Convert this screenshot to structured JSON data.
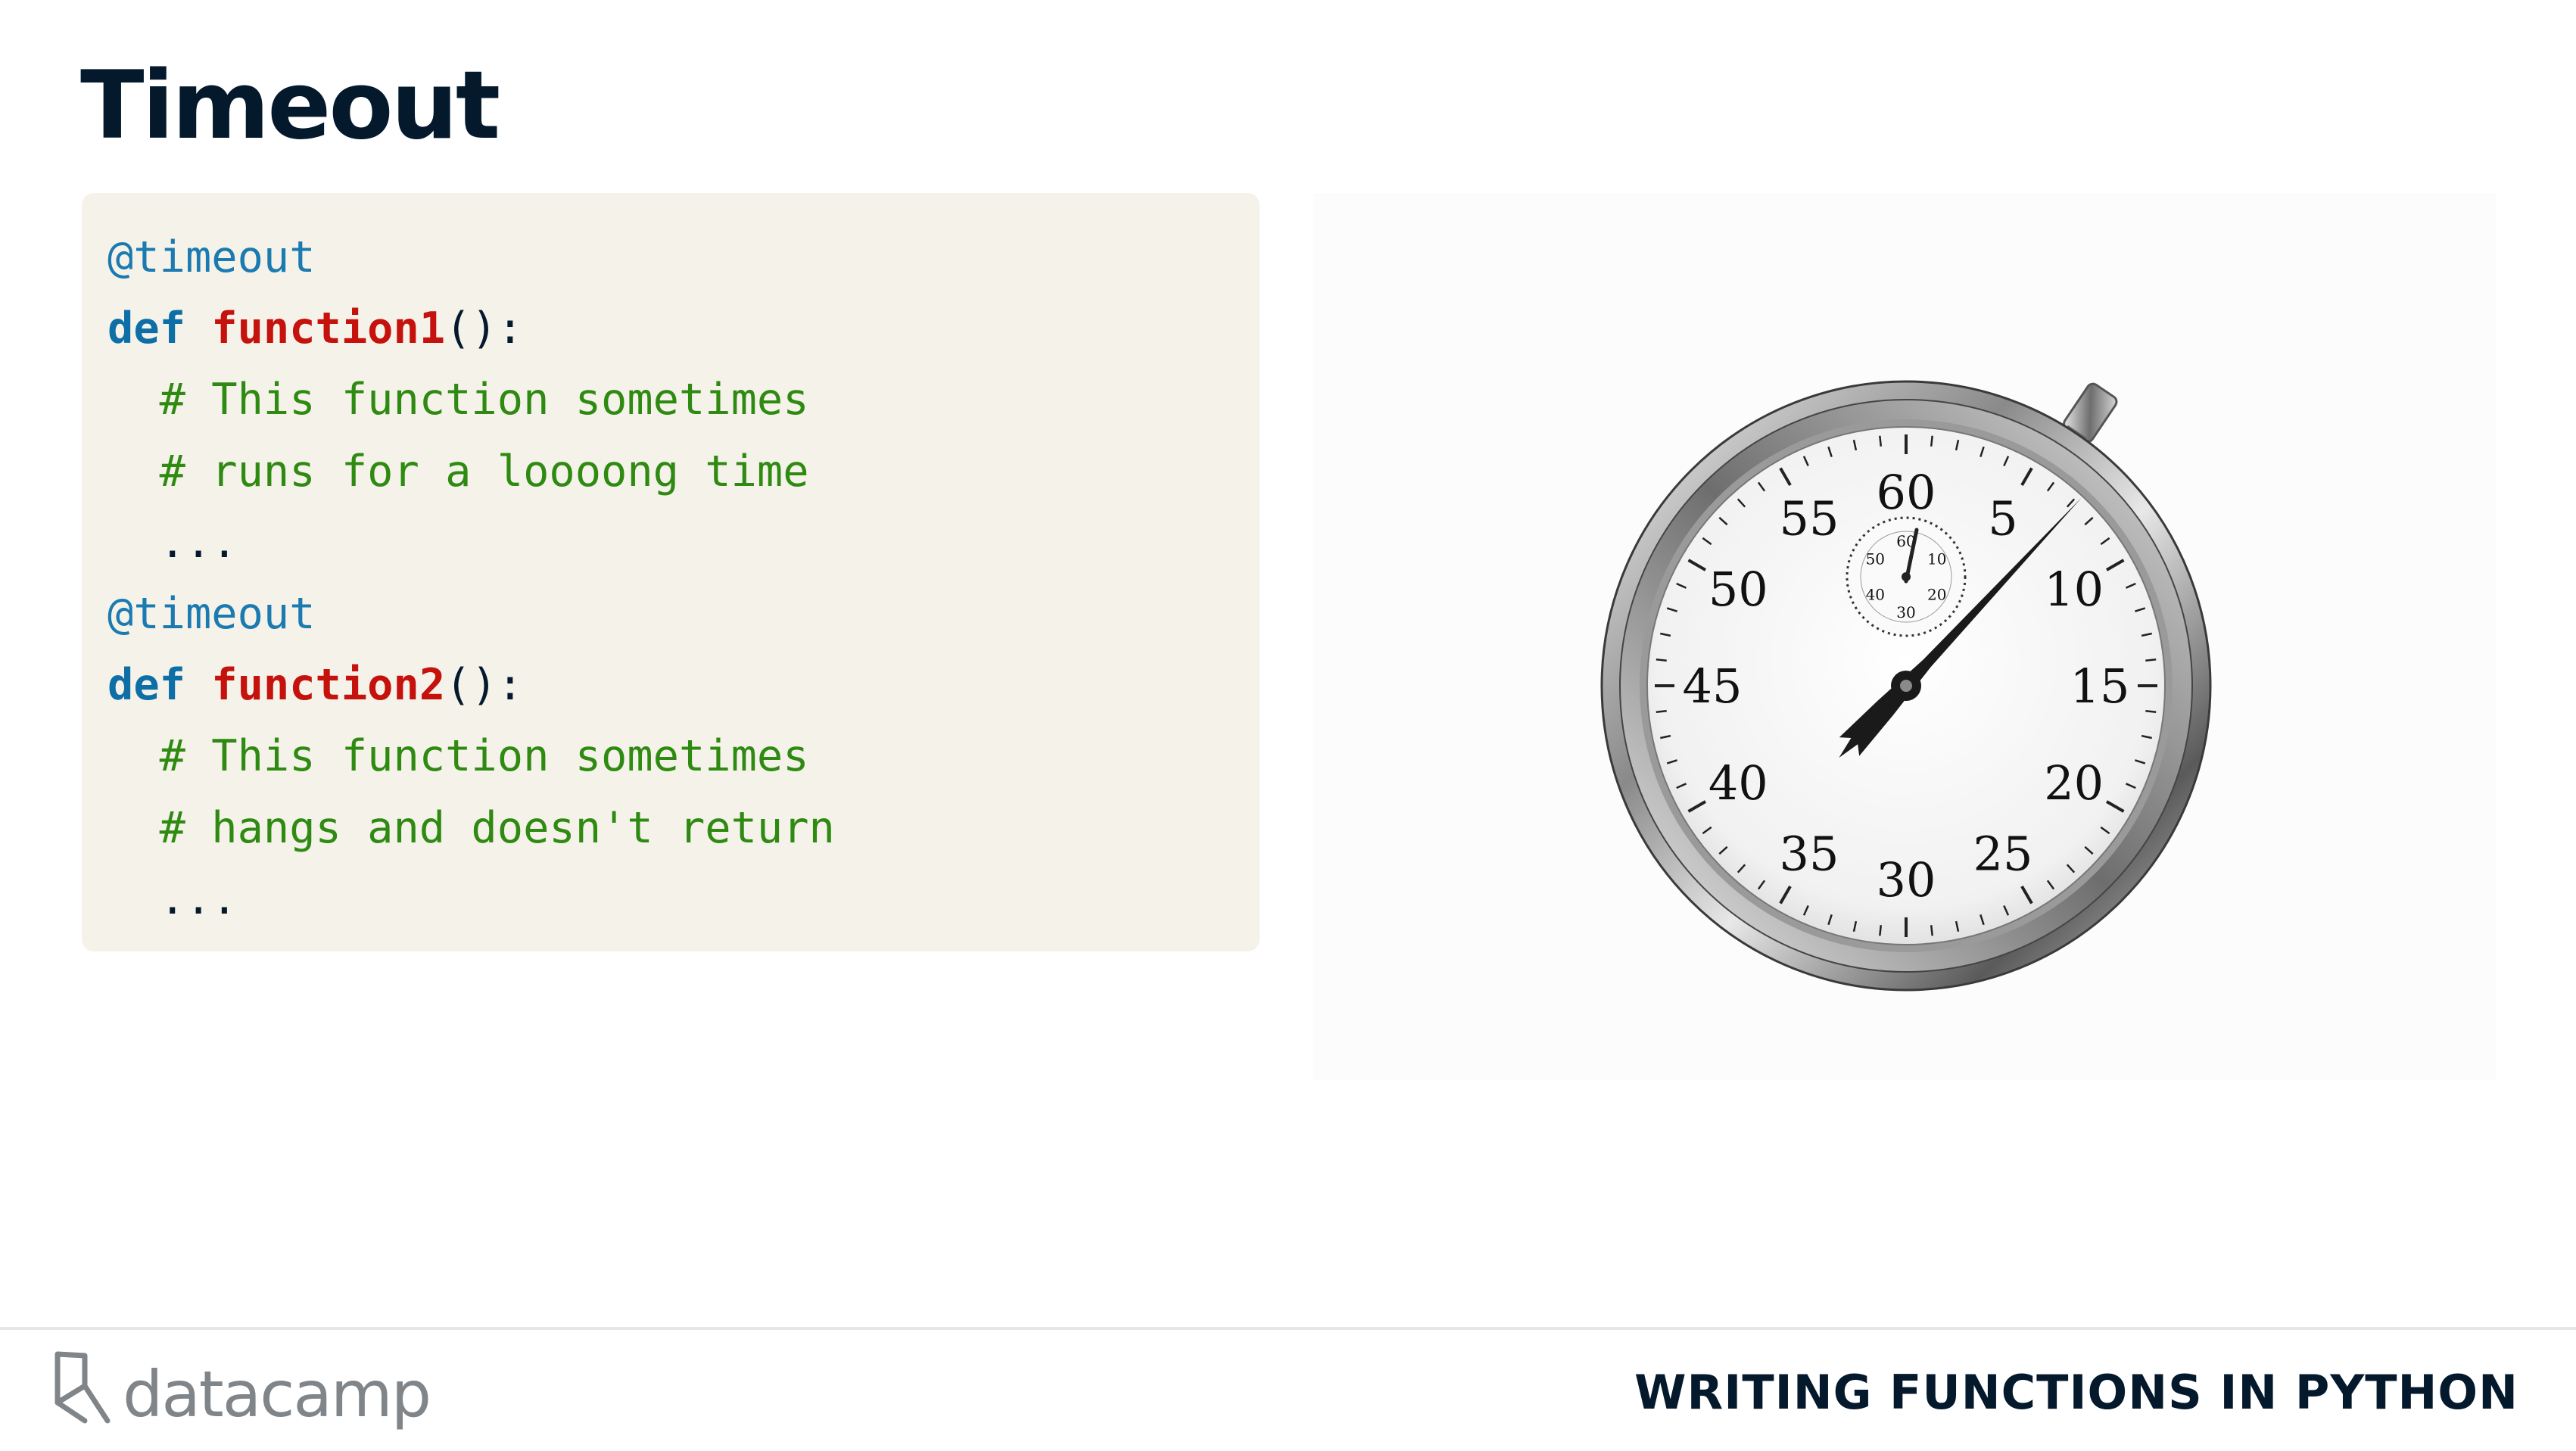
{
  "slide": {
    "title": "Timeout"
  },
  "code": {
    "lines": [
      [
        {
          "t": "@timeout",
          "c": "deco"
        }
      ],
      [
        {
          "t": "def",
          "c": "kw"
        },
        {
          "t": " ",
          "c": "plain"
        },
        {
          "t": "function1",
          "c": "fn"
        },
        {
          "t": "():",
          "c": "plain"
        }
      ],
      [
        {
          "t": "  # This function sometimes",
          "c": "comment"
        }
      ],
      [
        {
          "t": "  # runs for a loooong time",
          "c": "comment"
        }
      ],
      [
        {
          "t": "  ...",
          "c": "plain"
        }
      ],
      [
        {
          "t": "@timeout",
          "c": "deco"
        }
      ],
      [
        {
          "t": "def",
          "c": "kw"
        },
        {
          "t": " ",
          "c": "plain"
        },
        {
          "t": "function2",
          "c": "fn"
        },
        {
          "t": "():",
          "c": "plain"
        }
      ],
      [
        {
          "t": "  # This function sometimes",
          "c": "comment"
        }
      ],
      [
        {
          "t": "  # hangs and doesn't return",
          "c": "comment"
        }
      ],
      [
        {
          "t": "  ...",
          "c": "plain"
        }
      ]
    ]
  },
  "stopwatch": {
    "main_dial_labels": [
      "60",
      "5",
      "10",
      "15",
      "20",
      "25",
      "30",
      "35",
      "40",
      "45",
      "50",
      "55"
    ],
    "sub_dial_labels": [
      "60",
      "10",
      "20",
      "30",
      "40",
      "50"
    ]
  },
  "footer": {
    "logo_text": "datacamp",
    "course_title": "WRITING FUNCTIONS IN PYTHON"
  },
  "colors": {
    "title": "#05192d",
    "code_background": "#f5f2ea",
    "decorator": "#1b7ab0",
    "keyword": "#0d6fa6",
    "function_name": "#c5120c",
    "comment": "#2f8a12",
    "logo": "#808589"
  }
}
